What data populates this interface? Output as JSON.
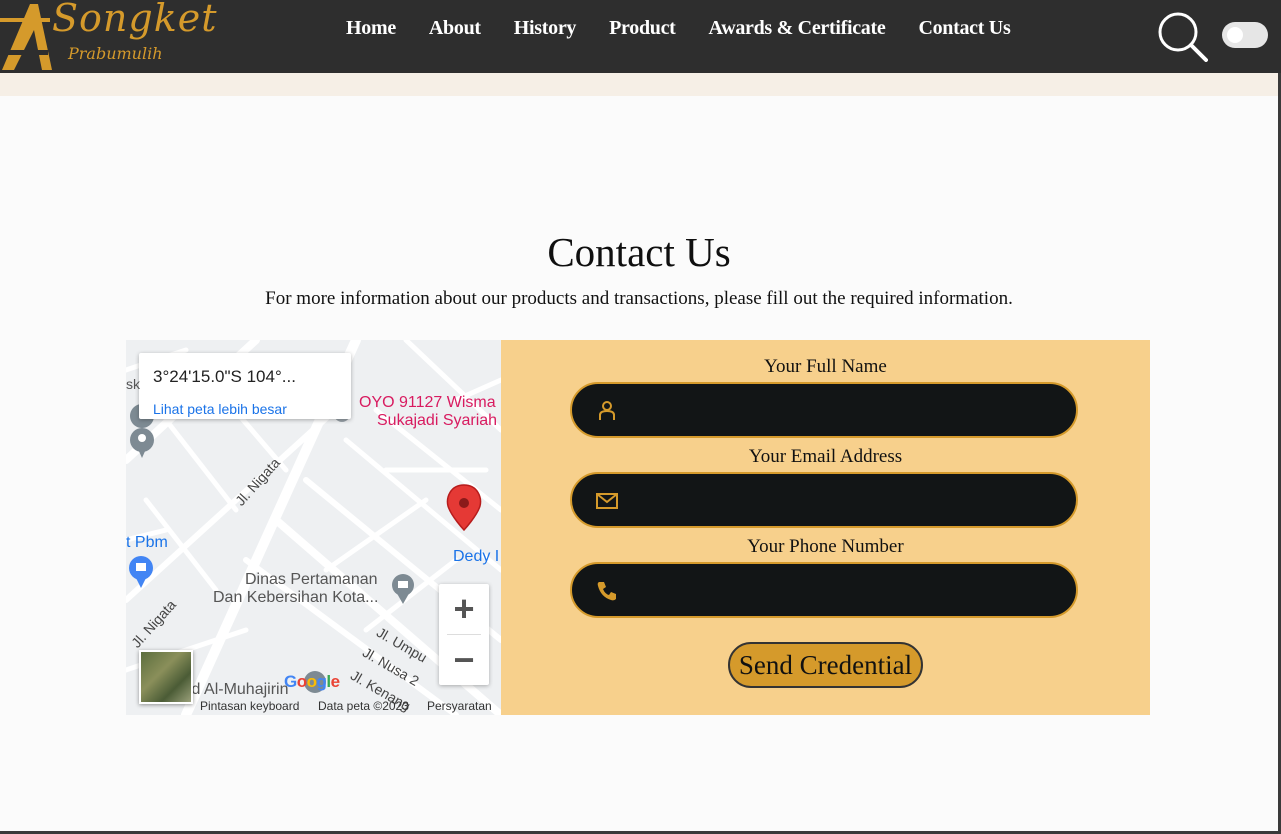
{
  "brand": {
    "name": "Songket",
    "sub": "Prabumulih",
    "accent": "#d59a2b"
  },
  "nav": {
    "items": [
      "Home",
      "About",
      "History",
      "Product",
      "Awards & Certificate",
      "Contact Us"
    ]
  },
  "header_icons": {
    "search": "search-icon",
    "theme_toggle": "toggle-switch"
  },
  "contact": {
    "title": "Contact Us",
    "subtitle": "For more information about our products and transactions, please fill out the required information."
  },
  "map": {
    "coordinates": "3°24'15.0\"S 104°...",
    "view_larger": "Lihat peta lebih besar",
    "labels": {
      "oyo": "OYO 91127 Wisma",
      "sukajadi": "Sukajadi Syariah",
      "pbm": "t Pbm",
      "nigata1": "Jl. Nigata",
      "nigata2": "Jl. Nigata",
      "dedy": "Dedy I",
      "dinas1": "Dinas Pertamanan",
      "dinas2": "Dan Kebersihan Kota...",
      "umpu": "Jl. Umpu",
      "nusa": "Jl. Nusa 2",
      "kenanga": "Jl. Kenang",
      "muhajirin": "id Al-Muhajirin",
      "sk": "sk"
    },
    "google": "Google",
    "footer": {
      "shortcuts": "Pintasan keyboard",
      "data": "Data peta ©2023",
      "terms": "Persyaratan"
    },
    "zoom_in": "+",
    "zoom_out": "−"
  },
  "form": {
    "name_label": "Your Full Name",
    "email_label": "Your Email Address",
    "phone_label": "Your Phone Number",
    "name_value": "",
    "email_value": "",
    "phone_value": "",
    "submit": "Send Credential"
  }
}
